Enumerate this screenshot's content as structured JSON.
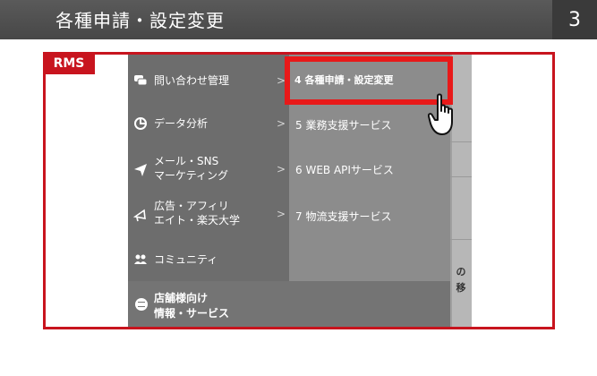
{
  "header": {
    "title": "各種申請・設定変更",
    "page_number": "3"
  },
  "tag": {
    "label": "RMS"
  },
  "menu": {
    "left_items": [
      {
        "icon": "chat-bubble-icon",
        "line1": "問い合わせ管理",
        "line2": ""
      },
      {
        "icon": "pie-chart-icon",
        "line1": "データ分析",
        "line2": ""
      },
      {
        "icon": "paper-plane-icon",
        "line1": "メール・SNS",
        "line2": "マーケティング"
      },
      {
        "icon": "megaphone-icon",
        "line1": "広告・アフィリ",
        "line2": "エイト・楽天大学"
      },
      {
        "icon": "people-icon",
        "line1": "コミュニティ",
        "line2": ""
      }
    ],
    "submenu_items": [
      "4 各種申請・設定変更",
      "5 業務支援サービス",
      "6 WEB APIサービス",
      "7 物流支援サービス"
    ],
    "bottom": {
      "line1": "店舗様向け",
      "line2": "情報・サービス"
    },
    "side_strip_text": {
      "line1": "の",
      "line2": "移"
    }
  },
  "colors": {
    "accent_red": "#c8141e",
    "highlight_red": "#e81919"
  }
}
